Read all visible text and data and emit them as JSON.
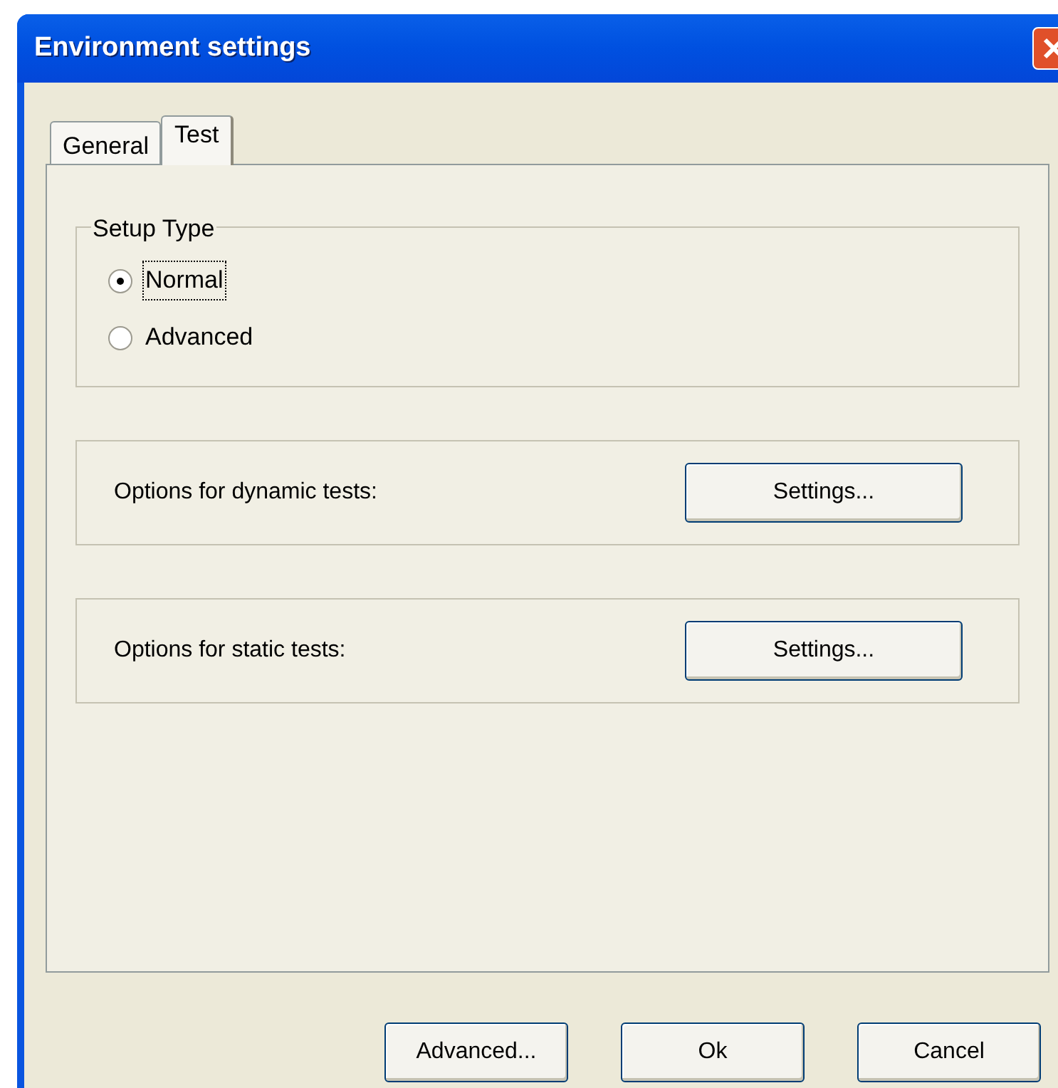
{
  "window": {
    "title": "Environment settings"
  },
  "tabs": [
    {
      "label": "General",
      "selected": false
    },
    {
      "label": "Test",
      "selected": true
    }
  ],
  "setup_type": {
    "title": "Setup Type",
    "options": [
      {
        "label": "Normal",
        "selected": true,
        "focused": true
      },
      {
        "label": "Advanced",
        "selected": false,
        "focused": false
      }
    ]
  },
  "option_groups": [
    {
      "label": "Options for dynamic tests:",
      "button": "Settings..."
    },
    {
      "label": "Options for static tests:",
      "button": "Settings..."
    }
  ],
  "buttons": [
    "Advanced...",
    "Ok",
    "Cancel"
  ]
}
